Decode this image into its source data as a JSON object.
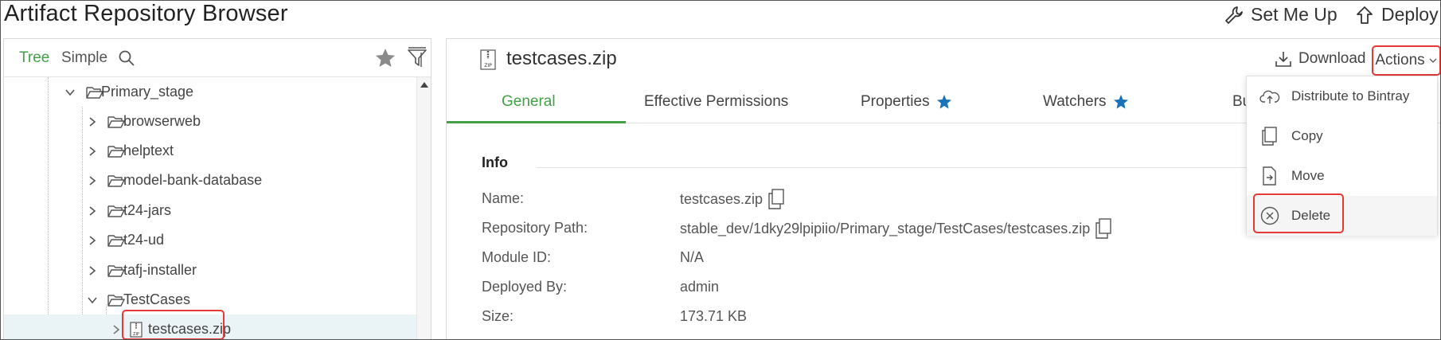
{
  "header": {
    "title": "Artifact Repository Browser",
    "set_me_up": "Set Me Up",
    "deploy": "Deploy"
  },
  "left": {
    "tree_tab": "Tree",
    "simple_tab": "Simple",
    "tree_items": [
      {
        "label": "Primary_stage",
        "expanded": true
      },
      {
        "label": "browserweb",
        "expanded": false
      },
      {
        "label": "helptext",
        "expanded": false
      },
      {
        "label": "model-bank-database",
        "expanded": false
      },
      {
        "label": "t24-jars",
        "expanded": false
      },
      {
        "label": "t24-ud",
        "expanded": false
      },
      {
        "label": "tafj-installer",
        "expanded": false
      },
      {
        "label": "TestCases",
        "expanded": true
      },
      {
        "label": "testcases.zip",
        "selected": true
      }
    ]
  },
  "right": {
    "file_name": "testcases.zip",
    "download": "Download",
    "actions": "Actions",
    "tabs": [
      {
        "label": "General",
        "active": true
      },
      {
        "label": "Effective Permissions"
      },
      {
        "label": "Properties",
        "starred": true
      },
      {
        "label": "Watchers",
        "starred": true
      },
      {
        "label": "Bu"
      }
    ],
    "section_title": "Info",
    "info": [
      {
        "label": "Name:",
        "value": "testcases.zip",
        "copy": true
      },
      {
        "label": "Repository Path:",
        "value": "stable_dev/1dky29lpipiio/Primary_stage/TestCases/testcases.zip",
        "copy": true
      },
      {
        "label": "Module ID:",
        "value": "N/A"
      },
      {
        "label": "Deployed By:",
        "value": "admin"
      },
      {
        "label": "Size:",
        "value": "173.71 KB"
      }
    ]
  },
  "actions_menu": [
    {
      "label": "Distribute to Bintray",
      "icon": "cloud-upload-icon"
    },
    {
      "label": "Copy",
      "icon": "copy-icon"
    },
    {
      "label": "Move",
      "icon": "move-icon"
    },
    {
      "label": "Delete",
      "icon": "delete-circle-icon"
    }
  ],
  "colors": {
    "accent_green": "#43a047",
    "highlight_red": "#e53935",
    "star_blue": "#1a73b8"
  }
}
